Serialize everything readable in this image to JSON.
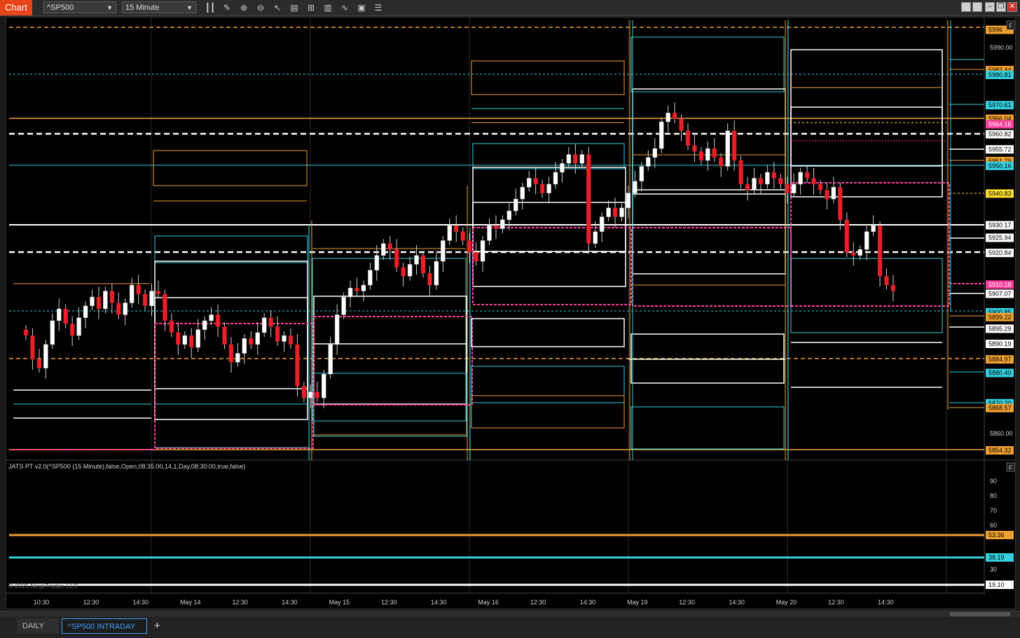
{
  "toolbar": {
    "title_tag": "Chart",
    "instrument": "^SP500",
    "interval": "15 Minute"
  },
  "indicator_label": "JATS PT v2.0(^SP500 (15 Minute),false,Open,08:35:00,14,1,Day,08:30:00,true,false)",
  "copyright": "© 2025 NinjaTrader, LLC",
  "price_axis": {
    "ticks": [
      "5990.00",
      "5860.00"
    ],
    "tags": [
      {
        "value": "5996",
        "color": "#f0a030",
        "text_color": "#000"
      },
      {
        "value": "5982.44",
        "color": "#f0a030",
        "text_color": "#000"
      },
      {
        "value": "5980.81",
        "color": "#35d0e0",
        "text_color": "#000"
      },
      {
        "value": "5970.61",
        "color": "#35d0e0",
        "text_color": "#000"
      },
      {
        "value": "5966.04",
        "color": "#f0a030",
        "text_color": "#000"
      },
      {
        "value": "5964.16",
        "color": "#ff3d9e",
        "text_color": "#fff"
      },
      {
        "value": "5960.82",
        "color": "#ffffff",
        "text_color": "#000"
      },
      {
        "value": "5955.72",
        "color": "#ffffff",
        "text_color": "#000"
      },
      {
        "value": "5951.79",
        "color": "#f0a030",
        "text_color": "#000"
      },
      {
        "value": "5950.16",
        "color": "#35d0e0",
        "text_color": "#000"
      },
      {
        "value": "5940.83",
        "color": "#ffe030",
        "text_color": "#000"
      },
      {
        "value": "5930.17",
        "color": "#ffffff",
        "text_color": "#000"
      },
      {
        "value": "5925.94",
        "color": "#ffffff",
        "text_color": "#000"
      },
      {
        "value": "5920.84",
        "color": "#ffffff",
        "text_color": "#000"
      },
      {
        "value": "5910.18",
        "color": "#ff3d9e",
        "text_color": "#fff"
      },
      {
        "value": "5907.07",
        "color": "#ffffff",
        "text_color": "#000"
      },
      {
        "value": "5900.85",
        "color": "#35d0e0",
        "text_color": "#000"
      },
      {
        "value": "5899.22",
        "color": "#f0a030",
        "text_color": "#000"
      },
      {
        "value": "5895.29",
        "color": "#ffffff",
        "text_color": "#000"
      },
      {
        "value": "5890.19",
        "color": "#ffffff",
        "text_color": "#000"
      },
      {
        "value": "5884.97",
        "color": "#f0a030",
        "text_color": "#000"
      },
      {
        "value": "5880.40",
        "color": "#35d0e0",
        "text_color": "#000"
      },
      {
        "value": "5870.20",
        "color": "#35d0e0",
        "text_color": "#000"
      },
      {
        "value": "5868.57",
        "color": "#f0a030",
        "text_color": "#000"
      },
      {
        "value": "5854.32",
        "color": "#f0a030",
        "text_color": "#000"
      }
    ]
  },
  "indicator_axis": {
    "ticks": [
      "90",
      "80",
      "70",
      "60",
      "30"
    ],
    "tags": [
      {
        "value": "53.36",
        "color": "#f0a030",
        "text_color": "#000"
      },
      {
        "value": "38.19",
        "color": "#35d0e0",
        "text_color": "#000"
      },
      {
        "value": "19.10",
        "color": "#ffffff",
        "text_color": "#000"
      }
    ]
  },
  "time_axis": [
    "10:30",
    "12:30",
    "14:30",
    "May 14",
    "12:30",
    "14:30",
    "May 15",
    "12:30",
    "14:30",
    "May 16",
    "12:30",
    "14:30",
    "May 19",
    "12:30",
    "14:30",
    "May 20",
    "12:30",
    "14:30"
  ],
  "tabs": [
    {
      "label": "DAILY"
    },
    {
      "label": "^SP500 INTRADAY"
    }
  ],
  "colors": {
    "orange": "#f0a030",
    "cyan": "#35d0e0",
    "white": "#ffffff",
    "magenta": "#ff3d9e",
    "yellow": "#ffe030",
    "up": "#ffffff",
    "down": "#e8202a"
  }
}
